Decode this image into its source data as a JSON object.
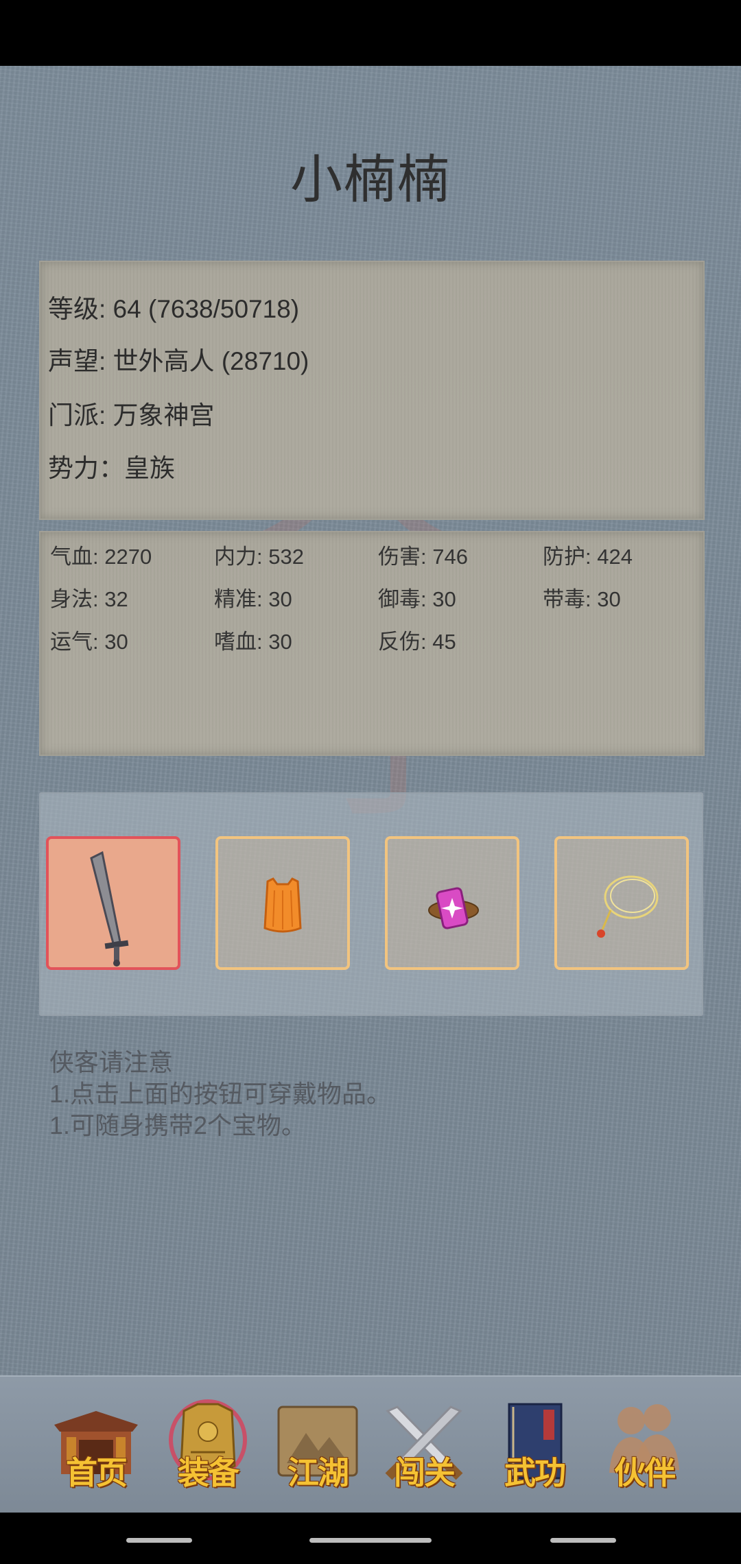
{
  "character": {
    "name": "小楠楠",
    "level_line": "等级: 64 (7638/50718)",
    "fame_line": "声望: 世外高人 (28710)",
    "sect_line": "门派: 万象神宫",
    "faction_line": "势力：皇族"
  },
  "stats": [
    [
      "气血: 2270",
      "内力: 532",
      "伤害: 746",
      "防护: 424"
    ],
    [
      "身法: 32",
      "精准: 30",
      "御毒: 30",
      "带毒: 30"
    ],
    [
      "运气: 30",
      "嗜血: 30",
      "反伤: 45"
    ]
  ],
  "equipment": [
    {
      "item": "weapon-saber-icon",
      "selected": true
    },
    {
      "item": "armor-robe-icon",
      "selected": false
    },
    {
      "item": "treasure-gem-icon",
      "selected": false
    },
    {
      "item": "necklace-icon",
      "selected": false
    }
  ],
  "notice": {
    "title": "侠客请注意",
    "line1": "1.点击上面的按钮可穿戴物品。",
    "line2": "1.可随身携带2个宝物。"
  },
  "tabs": [
    {
      "label": "首页",
      "icon": "house-icon"
    },
    {
      "label": "装备",
      "icon": "armor-icon",
      "active": true
    },
    {
      "label": "江湖",
      "icon": "scroll-map-icon"
    },
    {
      "label": "闯关",
      "icon": "crossed-swords-icon"
    },
    {
      "label": "武功",
      "icon": "book-icon"
    },
    {
      "label": "伙伴",
      "icon": "partners-icon"
    }
  ],
  "colors": {
    "accent_gold": "#f5c233",
    "selected_slot_border": "#e2535a",
    "slot_border": "#f2c47f"
  }
}
